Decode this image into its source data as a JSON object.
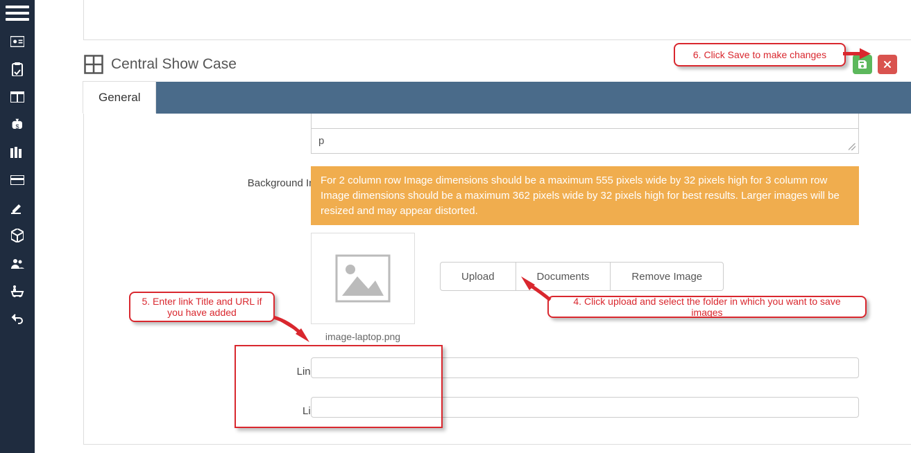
{
  "sidebar": {
    "items": [
      {
        "name": "menu"
      },
      {
        "name": "id-card"
      },
      {
        "name": "clipboard"
      },
      {
        "name": "columns"
      },
      {
        "name": "money-bag"
      },
      {
        "name": "books"
      },
      {
        "name": "card"
      },
      {
        "name": "edit-pen"
      },
      {
        "name": "cube"
      },
      {
        "name": "users"
      },
      {
        "name": "cart-person"
      },
      {
        "name": "undo"
      }
    ]
  },
  "header": {
    "title": "Central Show Case"
  },
  "actions": {
    "save_tip": "Save",
    "cancel_tip": "Cancel"
  },
  "tabs": [
    {
      "label": "General",
      "active": true
    }
  ],
  "editor": {
    "path_indicator": "p"
  },
  "form": {
    "background_image_label": "Background Image :",
    "background_image_help": "For 2 column row Image dimensions should be a maximum 555 pixels wide by 32 pixels high for 3 column row Image dimensions should be a maximum 362 pixels wide by 32 pixels high for best results. Larger images will be resized and may appear distorted.",
    "image_filename": "image-laptop.png",
    "buttons": {
      "upload": "Upload",
      "documents": "Documents",
      "remove": "Remove Image"
    },
    "link_title_label": "Link Title:",
    "link_title_value": "",
    "link_url_label": "Link Url:",
    "link_url_value": ""
  },
  "callouts": {
    "c4": "4. Click upload and select the folder in which you want to save images",
    "c5": "5. Enter link Title and URL  if you have added",
    "c6": "6. Click Save to make changes"
  }
}
